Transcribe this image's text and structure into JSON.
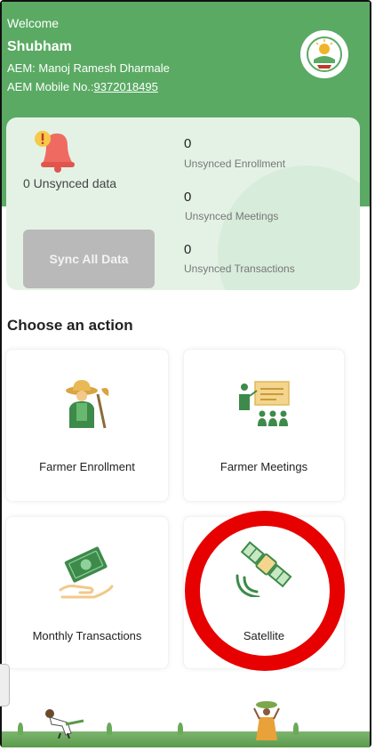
{
  "header": {
    "welcome": "Welcome",
    "user_name": "Shubham",
    "aem_label": "AEM:",
    "aem_name": "Manoj Ramesh Dharmale",
    "aem_mobile_label": "AEM Mobile No.:",
    "aem_mobile": "9372018495"
  },
  "sync": {
    "unsynced_data_text": "0 Unsynced data",
    "button_label": "Sync All Data",
    "stats": [
      {
        "value": "0",
        "label": "Unsynced Enrollment"
      },
      {
        "value": "0",
        "label": "Unsynced Meetings"
      },
      {
        "value": "0",
        "label": "Unsynced Transactions"
      }
    ]
  },
  "actions": {
    "title": "Choose an action",
    "tiles": [
      {
        "label": "Farmer Enrollment",
        "icon": "farmer-icon"
      },
      {
        "label": "Farmer Meetings",
        "icon": "meeting-icon"
      },
      {
        "label": "Monthly Transactions",
        "icon": "money-hand-icon"
      },
      {
        "label": "Satellite",
        "icon": "satellite-icon"
      }
    ]
  },
  "colors": {
    "header_green": "#5aaa63",
    "card_green": "#e4f2e6",
    "highlight_red": "#e60000"
  }
}
